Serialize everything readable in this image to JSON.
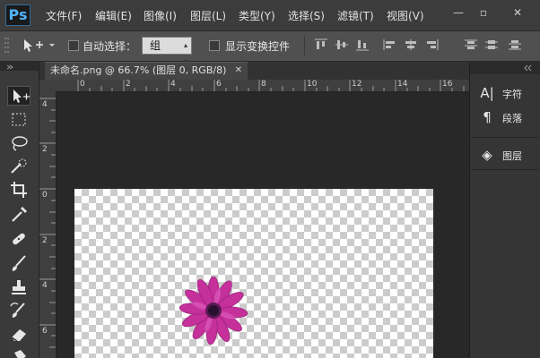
{
  "app": {
    "logo": "Ps"
  },
  "menu": [
    "文件(F)",
    "编辑(E)",
    "图像(I)",
    "图层(L)",
    "类型(Y)",
    "选择(S)",
    "滤镜(T)",
    "视图(V)"
  ],
  "window_controls": {
    "minimize": "—",
    "maximize": "▫",
    "close": "✕"
  },
  "options": {
    "auto_select_label": "自动选择：",
    "auto_select_value": "组",
    "show_transform_label": "显示变换控件"
  },
  "document": {
    "tab_title": "未命名.png @ 66.7% (图层 0, RGB/8)",
    "tab_close": "✕"
  },
  "ruler": {
    "top_ticks": [
      "0",
      "2",
      "4",
      "6",
      "8",
      "10",
      "12",
      "14",
      "16"
    ],
    "left_ticks": [
      "4",
      "2",
      "0",
      "2",
      "4",
      "6",
      "8"
    ]
  },
  "panels": [
    {
      "icon": "character-icon",
      "glyph": "A|",
      "label": "字符"
    },
    {
      "icon": "paragraph-icon",
      "glyph": "¶",
      "label": "段落"
    },
    {
      "icon": "layers-icon",
      "glyph": "◈",
      "label": "图层"
    }
  ],
  "colors": {
    "flower": "#c5309a",
    "flower_center": "#2a1030",
    "accent": "#4fb3ff"
  }
}
